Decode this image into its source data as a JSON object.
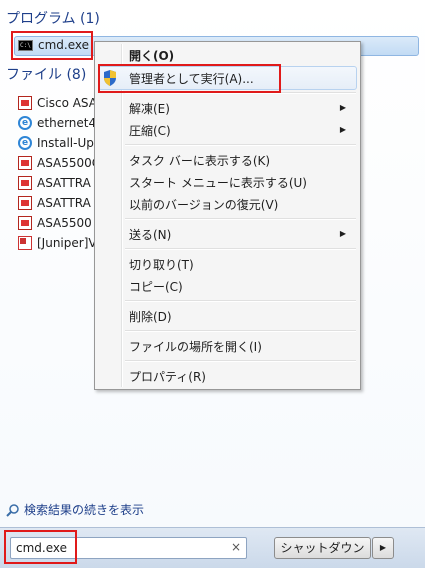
{
  "programs": {
    "title": "プログラム (1)",
    "items": [
      {
        "label": "cmd.exe",
        "icon": "cmd-icon"
      }
    ]
  },
  "files": {
    "title": "ファイル (8)",
    "items": [
      {
        "label": "Cisco ASA",
        "icon": "pdf-icon"
      },
      {
        "label": "ethernet4",
        "icon": "ie-icon"
      },
      {
        "label": "Install-Up",
        "icon": "ie-icon"
      },
      {
        "label": "ASA5500C",
        "icon": "pdf-icon"
      },
      {
        "label": "ASATTRA",
        "icon": "pdf-icon"
      },
      {
        "label": "ASATTRA",
        "icon": "pdf-icon"
      },
      {
        "label": "ASA5500",
        "icon": "pdf-icon"
      },
      {
        "label": "[Juniper]V",
        "icon": "juniper-pdf-icon"
      }
    ]
  },
  "context_menu": {
    "items": [
      {
        "label": "開く(O)"
      },
      {
        "label": "管理者として実行(A)..."
      },
      {
        "label": "解凍(E)"
      },
      {
        "label": "圧縮(C)"
      },
      {
        "label": "タスク バーに表示する(K)"
      },
      {
        "label": "スタート メニューに表示する(U)"
      },
      {
        "label": "以前のバージョンの復元(V)"
      },
      {
        "label": "送る(N)"
      },
      {
        "label": "切り取り(T)"
      },
      {
        "label": "コピー(C)"
      },
      {
        "label": "削除(D)"
      },
      {
        "label": "ファイルの場所を開く(I)"
      },
      {
        "label": "プロパティ(R)"
      }
    ],
    "submenu_arrow": "▶"
  },
  "more_results": {
    "label": "検索結果の続きを表示"
  },
  "search": {
    "value": "cmd.exe",
    "clear": "×"
  },
  "shutdown": {
    "label": "シャットダウン",
    "arrow": "▶"
  },
  "colors": {
    "accent": "#1e3f8a",
    "highlight_box": "#e01a1a",
    "hover": "#c2dbf4"
  }
}
